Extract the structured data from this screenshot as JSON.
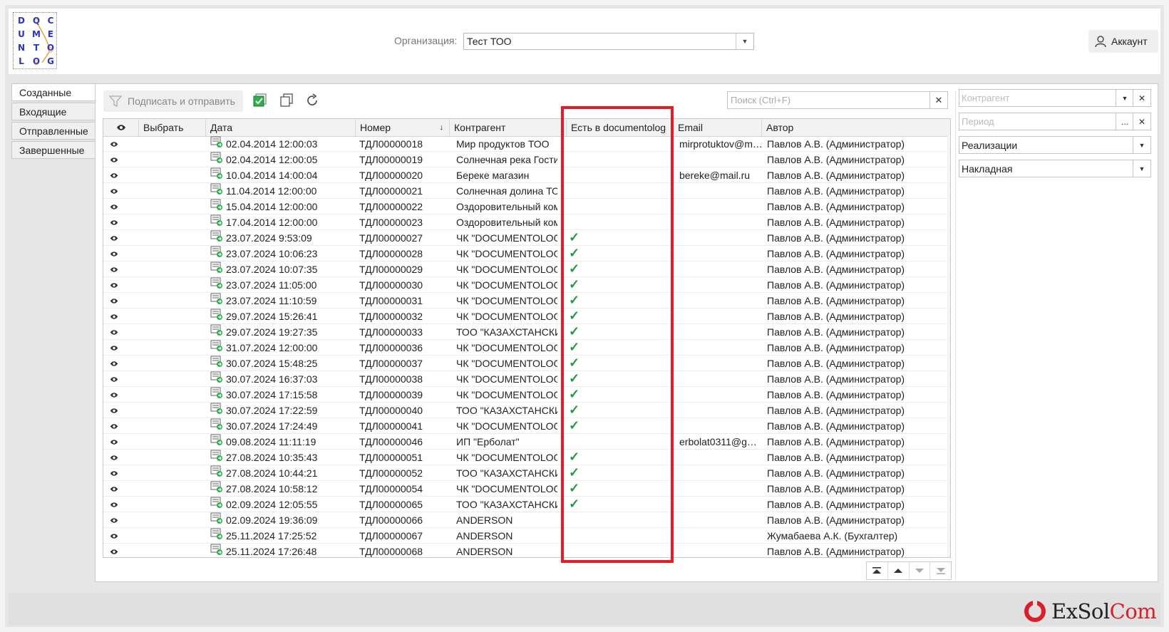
{
  "header": {
    "logo_letters": [
      "D",
      "Q",
      "C",
      "U",
      "M",
      "E",
      "N",
      "T",
      "O",
      "L",
      "O",
      "G"
    ],
    "org_label": "Организация:",
    "org_value": "Тест ТОО",
    "account_label": "Аккаунт"
  },
  "tabs": [
    "Созданные",
    "Входящие",
    "Отправленные",
    "Завершенные"
  ],
  "toolbar": {
    "sign_send_label": "Подписать и отправить",
    "search_placeholder": "Поиск (Ctrl+F)"
  },
  "table": {
    "columns": [
      "Выбрать",
      "Дата",
      "Номер",
      "Контрагент",
      "Есть в documentolog",
      "Email",
      "Автор"
    ],
    "rows": [
      {
        "date": "02.04.2014 12:00:03",
        "number": "ТДЛ00000018",
        "kontragent": "Мир продуктов ТОО",
        "in_dl": false,
        "email": "mirprotuktov@ma...",
        "author": "Павлов А.В. (Администратор)"
      },
      {
        "date": "02.04.2014 12:00:05",
        "number": "ТДЛ00000019",
        "kontragent": "Солнечная река Гости",
        "in_dl": false,
        "email": "",
        "author": "Павлов А.В. (Администратор)"
      },
      {
        "date": "10.04.2014 14:00:04",
        "number": "ТДЛ00000020",
        "kontragent": "Береке магазин",
        "in_dl": false,
        "email": "bereke@mail.ru",
        "author": "Павлов А.В. (Администратор)"
      },
      {
        "date": "11.04.2014 12:00:00",
        "number": "ТДЛ00000021",
        "kontragent": "Солнечная долина ТОО",
        "in_dl": false,
        "email": "",
        "author": "Павлов А.В. (Администратор)"
      },
      {
        "date": "15.04.2014 12:00:00",
        "number": "ТДЛ00000022",
        "kontragent": "Оздоровительный ком",
        "in_dl": false,
        "email": "",
        "author": "Павлов А.В. (Администратор)"
      },
      {
        "date": "17.04.2014 12:00:00",
        "number": "ТДЛ00000023",
        "kontragent": "Оздоровительный ком",
        "in_dl": false,
        "email": "",
        "author": "Павлов А.В. (Администратор)"
      },
      {
        "date": "23.07.2024 9:53:09",
        "number": "ТДЛ00000027",
        "kontragent": "ЧК \"DOCUMENTOLOG",
        "in_dl": true,
        "email": "",
        "author": "Павлов А.В. (Администратор)"
      },
      {
        "date": "23.07.2024 10:06:23",
        "number": "ТДЛ00000028",
        "kontragent": "ЧК \"DOCUMENTOLOG",
        "in_dl": true,
        "email": "",
        "author": "Павлов А.В. (Администратор)"
      },
      {
        "date": "23.07.2024 10:07:35",
        "number": "ТДЛ00000029",
        "kontragent": "ЧК \"DOCUMENTOLOG",
        "in_dl": true,
        "email": "",
        "author": "Павлов А.В. (Администратор)"
      },
      {
        "date": "23.07.2024 11:05:00",
        "number": "ТДЛ00000030",
        "kontragent": "ЧК \"DOCUMENTOLOG",
        "in_dl": true,
        "email": "",
        "author": "Павлов А.В. (Администратор)"
      },
      {
        "date": "23.07.2024 11:10:59",
        "number": "ТДЛ00000031",
        "kontragent": "ЧК \"DOCUMENTOLOG",
        "in_dl": true,
        "email": "",
        "author": "Павлов А.В. (Администратор)"
      },
      {
        "date": "29.07.2024 15:26:41",
        "number": "ТДЛ00000032",
        "kontragent": "ЧК \"DOCUMENTOLOG",
        "in_dl": true,
        "email": "",
        "author": "Павлов А.В. (Администратор)"
      },
      {
        "date": "29.07.2024 19:27:35",
        "number": "ТДЛ00000033",
        "kontragent": "ТОО \"КАЗАХСТАНСКИ",
        "in_dl": true,
        "email": "",
        "author": "Павлов А.В. (Администратор)"
      },
      {
        "date": "31.07.2024 12:00:00",
        "number": "ТДЛ00000036",
        "kontragent": "ЧК \"DOCUMENTOLOG",
        "in_dl": true,
        "email": "",
        "author": "Павлов А.В. (Администратор)"
      },
      {
        "date": "30.07.2024 15:48:25",
        "number": "ТДЛ00000037",
        "kontragent": "ЧК \"DOCUMENTOLOG",
        "in_dl": true,
        "email": "",
        "author": "Павлов А.В. (Администратор)"
      },
      {
        "date": "30.07.2024 16:37:03",
        "number": "ТДЛ00000038",
        "kontragent": "ЧК \"DOCUMENTOLOG",
        "in_dl": true,
        "email": "",
        "author": "Павлов А.В. (Администратор)"
      },
      {
        "date": "30.07.2024 17:15:58",
        "number": "ТДЛ00000039",
        "kontragent": "ЧК \"DOCUMENTOLOG",
        "in_dl": true,
        "email": "",
        "author": "Павлов А.В. (Администратор)"
      },
      {
        "date": "30.07.2024 17:22:59",
        "number": "ТДЛ00000040",
        "kontragent": "ТОО \"КАЗАХСТАНСКИ",
        "in_dl": true,
        "email": "",
        "author": "Павлов А.В. (Администратор)"
      },
      {
        "date": "30.07.2024 17:24:49",
        "number": "ТДЛ00000041",
        "kontragent": "ЧК \"DOCUMENTOLOG",
        "in_dl": true,
        "email": "",
        "author": "Павлов А.В. (Администратор)"
      },
      {
        "date": "09.08.2024 11:11:19",
        "number": "ТДЛ00000046",
        "kontragent": "ИП \"Ерболат\"",
        "in_dl": false,
        "email": "erbolat0311@gm...",
        "author": "Павлов А.В. (Администратор)"
      },
      {
        "date": "27.08.2024 10:35:43",
        "number": "ТДЛ00000051",
        "kontragent": "ЧК \"DOCUMENTOLOG",
        "in_dl": true,
        "email": "",
        "author": "Павлов А.В. (Администратор)"
      },
      {
        "date": "27.08.2024 10:44:21",
        "number": "ТДЛ00000052",
        "kontragent": "ТОО \"КАЗАХСТАНСКИ",
        "in_dl": true,
        "email": "",
        "author": "Павлов А.В. (Администратор)"
      },
      {
        "date": "27.08.2024 10:58:12",
        "number": "ТДЛ00000054",
        "kontragent": "ЧК \"DOCUMENTOLOG",
        "in_dl": true,
        "email": "",
        "author": "Павлов А.В. (Администратор)"
      },
      {
        "date": "02.09.2024 12:05:55",
        "number": "ТДЛ00000065",
        "kontragent": "ТОО \"КАЗАХСТАНСКИ",
        "in_dl": true,
        "email": "",
        "author": "Павлов А.В. (Администратор)"
      },
      {
        "date": "02.09.2024 19:36:09",
        "number": "ТДЛ00000066",
        "kontragent": "ANDERSON",
        "in_dl": false,
        "email": "",
        "author": "Павлов А.В. (Администратор)"
      },
      {
        "date": "25.11.2024 17:25:52",
        "number": "ТДЛ00000067",
        "kontragent": "ANDERSON",
        "in_dl": false,
        "email": "",
        "author": "Жумабаева А.К. (Бухгалтер)"
      },
      {
        "date": "25.11.2024 17:26:48",
        "number": "ТДЛ00000068",
        "kontragent": "ANDERSON",
        "in_dl": false,
        "email": "",
        "author": "Павлов А.В. (Администратор)"
      }
    ]
  },
  "filters": {
    "kontragent_placeholder": "Контрагент",
    "period_placeholder": "Период",
    "type_value": "Реализации",
    "doc_value": "Накладная",
    "ellipsis": "..."
  },
  "footer": {
    "brand_prefix": "ExSol",
    "brand_suffix": "Com"
  },
  "colors": {
    "check": "#1f9b3e",
    "highlight": "#e31d24",
    "logo": "#2b33c5"
  }
}
